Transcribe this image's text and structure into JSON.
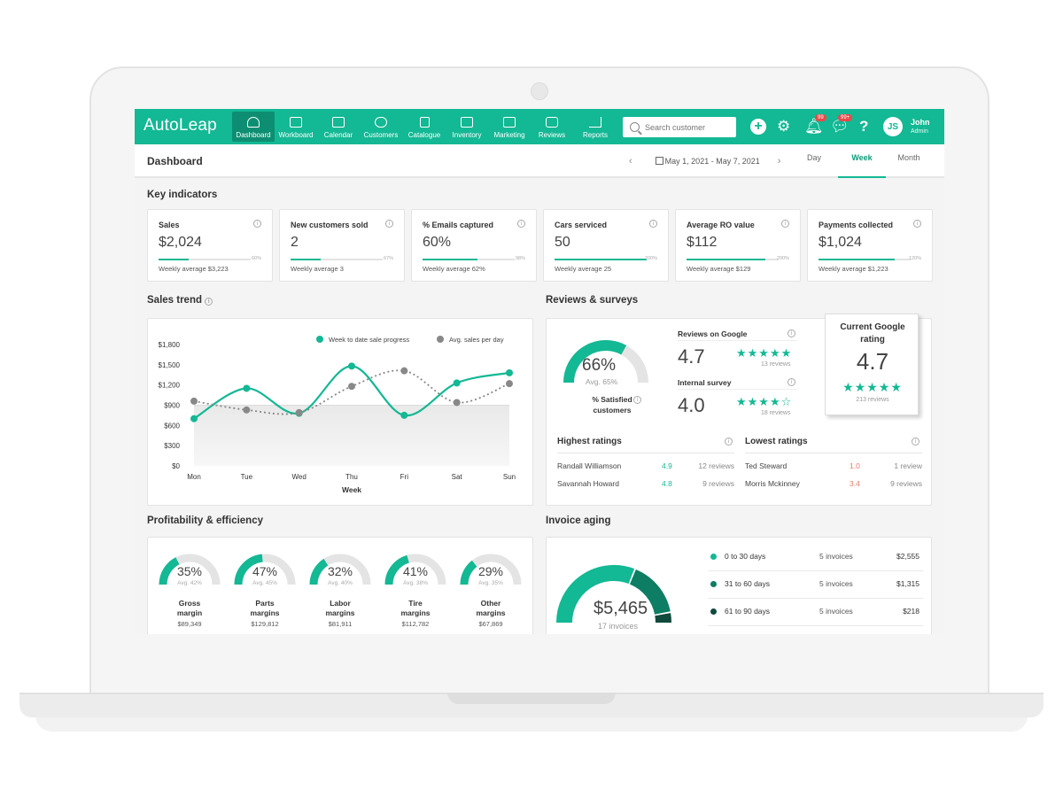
{
  "nav": {
    "logo": "AutoLeap",
    "items": [
      {
        "label": "Dashboard",
        "active": true
      },
      {
        "label": "Workboard"
      },
      {
        "label": "Calendar"
      },
      {
        "label": "Customers"
      },
      {
        "label": "Catalogue"
      },
      {
        "label": "Inventory"
      },
      {
        "label": "Marketing"
      },
      {
        "label": "Reviews"
      },
      {
        "label": "Reports"
      }
    ],
    "search_placeholder": "Search customer",
    "notif_badge": "99",
    "chat_badge": "99+",
    "user_initials": "JS",
    "user_name": "John",
    "user_role": "Admin"
  },
  "subheader": {
    "title": "Dashboard",
    "date_range": "May 1, 2021 - May 7, 2021",
    "tabs": [
      "Day",
      "Week",
      "Month"
    ],
    "active_tab": "Week"
  },
  "key_indicators": {
    "title": "Key indicators",
    "cards": [
      {
        "label": "Sales",
        "value": "$2,024",
        "target": "60%",
        "progress": 0.33,
        "weekly": "Weekly average $3,223"
      },
      {
        "label": "New customers sold",
        "value": "2",
        "target": "67%",
        "progress": 0.33,
        "weekly": "Weekly average 3"
      },
      {
        "label": "% Emails captured",
        "value": "60%",
        "target": "98%",
        "progress": 0.6,
        "weekly": "Weekly average 62%"
      },
      {
        "label": "Cars serviced",
        "value": "50",
        "target": "200%",
        "progress": 1.0,
        "weekly": "Weekly average 25"
      },
      {
        "label": "Average RO value",
        "value": "$112",
        "target": "200%",
        "progress": 0.86,
        "weekly": "Weekly average $129"
      },
      {
        "label": "Payments collected",
        "value": "$1,024",
        "target": "120%",
        "progress": 0.83,
        "weekly": "Weekly average $1,223"
      }
    ]
  },
  "sales_trend": {
    "title": "Sales trend",
    "chart_data": {
      "type": "line",
      "x": [
        "Mon",
        "Tue",
        "Wed",
        "Thu",
        "Fri",
        "Sat",
        "Sun"
      ],
      "xlabel": "Week",
      "ylim": [
        0,
        1800
      ],
      "yticks": [
        "$0",
        "$300",
        "$600",
        "$900",
        "$1,200",
        "$1,500",
        "$1,800"
      ],
      "series": [
        {
          "name": "Week to date sale progress",
          "color": "#13b894",
          "values": [
            700,
            1150,
            780,
            1480,
            750,
            1230,
            1380
          ]
        },
        {
          "name": "Avg. sales per day",
          "color": "#888888",
          "values": [
            960,
            830,
            790,
            1180,
            1410,
            940,
            1220
          ]
        }
      ]
    }
  },
  "reviews": {
    "title": "Reviews & surveys",
    "satisfied_pct": "66%",
    "satisfied_value": 0.66,
    "satisfied_avg": "Avg. 65%",
    "satisfied_label": "% Satisfied customers",
    "google_label": "Reviews on Google",
    "google_score": "4.7",
    "google_count": "13 reviews",
    "internal_label": "Internal survey",
    "internal_score": "4.0",
    "internal_count": "18 reviews",
    "current_title": "Current Google rating",
    "current_score": "4.7",
    "current_count": "213 reviews",
    "highest_title": "Highest ratings",
    "highest": [
      {
        "name": "Randall Williamson",
        "score": "4.9",
        "count": "12 reviews"
      },
      {
        "name": "Savannah Howard",
        "score": "4.8",
        "count": "9 reviews"
      }
    ],
    "lowest_title": "Lowest ratings",
    "lowest": [
      {
        "name": "Ted Steward",
        "score": "1.0",
        "count": "1 review"
      },
      {
        "name": "Morris Mckinney",
        "score": "3.4",
        "count": "9 reviews"
      }
    ]
  },
  "profitability": {
    "title": "Profitability & efficiency",
    "items": [
      {
        "pct": "35%",
        "value": 0.35,
        "avg": "Avg. 42%",
        "name": "Gross margin",
        "amount": "$89,349"
      },
      {
        "pct": "47%",
        "value": 0.47,
        "avg": "Avg. 45%",
        "name": "Parts margins",
        "amount": "$129,812"
      },
      {
        "pct": "32%",
        "value": 0.32,
        "avg": "Avg. 40%",
        "name": "Labor margins",
        "amount": "$81,911"
      },
      {
        "pct": "41%",
        "value": 0.41,
        "avg": "Avg. 38%",
        "name": "Tire margins",
        "amount": "$112,782"
      },
      {
        "pct": "29%",
        "value": 0.29,
        "avg": "Avg. 35%",
        "name": "Other margins",
        "amount": "$67,869"
      }
    ]
  },
  "invoice_aging": {
    "title": "Invoice aging",
    "total": "$5,465",
    "total_count": "17 invoices",
    "rows": [
      {
        "range": "0 to 30 days",
        "count": "5 invoices",
        "amount": "$2,555",
        "color": "#13b894"
      },
      {
        "range": "31 to 60 days",
        "count": "5 invoices",
        "amount": "$1,315",
        "color": "#0d7d63"
      },
      {
        "range": "61 to 90 days",
        "count": "5 invoices",
        "amount": "$218",
        "color": "#0f4a3c"
      }
    ]
  },
  "colors": {
    "accent": "#13b894",
    "accent_dark": "#0d8e72",
    "bad": "#e07b6a"
  }
}
